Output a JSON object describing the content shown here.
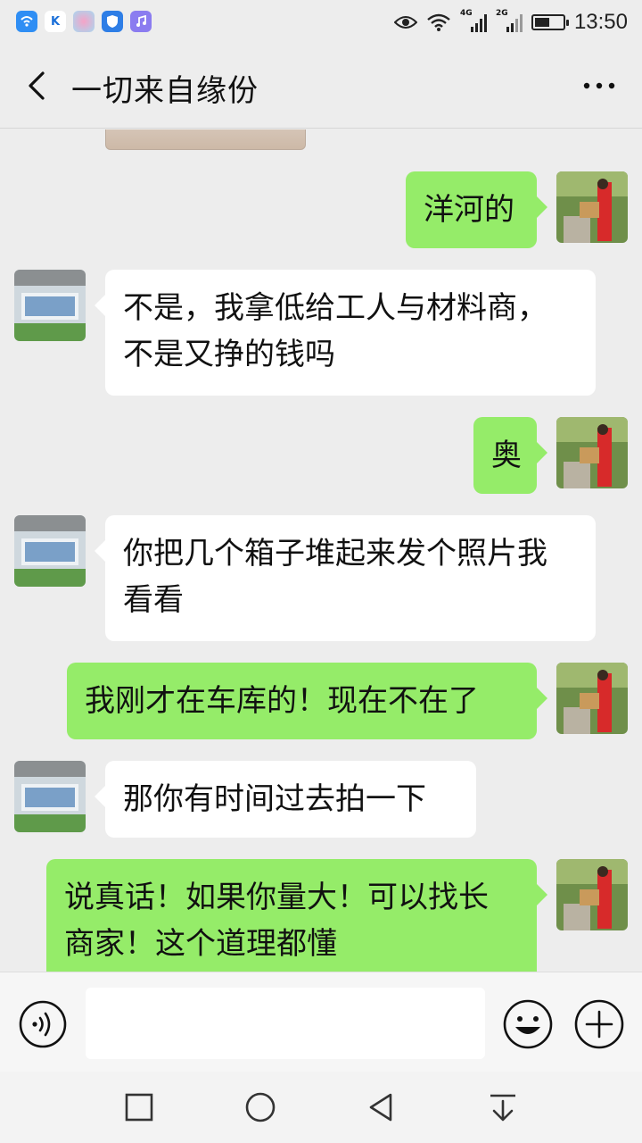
{
  "status_bar": {
    "time": "13:50",
    "network_1": "4G",
    "network_2": "2G",
    "battery_level": 0.55,
    "app_icons": [
      "wifi-app-icon",
      "tracker-app-icon",
      "photos-app-icon",
      "security-app-icon",
      "music-app-icon"
    ]
  },
  "header": {
    "title": "一切来自缘份",
    "back_icon": "chevron-left-icon",
    "more_icon": "ellipsis-icon"
  },
  "messages": [
    {
      "side": "out",
      "text": "洋河的"
    },
    {
      "side": "in",
      "text": "不是，我拿低给工人与材料商，\n不是又挣的钱吗"
    },
    {
      "side": "out",
      "text": "奥"
    },
    {
      "side": "in",
      "text": "你把几个箱子堆起来发个照片我\n看看"
    },
    {
      "side": "out",
      "text": "我刚才在车库的！现在不在了"
    },
    {
      "side": "in",
      "text": "那你有时间过去拍一下"
    },
    {
      "side": "out",
      "text": "说真话！如果你量大！可以找长\n商家！这个道理都懂"
    }
  ],
  "input_bar": {
    "value": "",
    "voice_icon": "voice-icon",
    "emoji_icon": "emoji-icon",
    "plus_icon": "plus-icon"
  },
  "nav_bar": {
    "buttons": [
      "recent-apps-icon",
      "home-icon",
      "back-triangle-icon",
      "notification-pull-icon"
    ]
  },
  "colors": {
    "background": "#ededed",
    "outgoing_bubble": "#95ec69",
    "incoming_bubble": "#ffffff"
  }
}
